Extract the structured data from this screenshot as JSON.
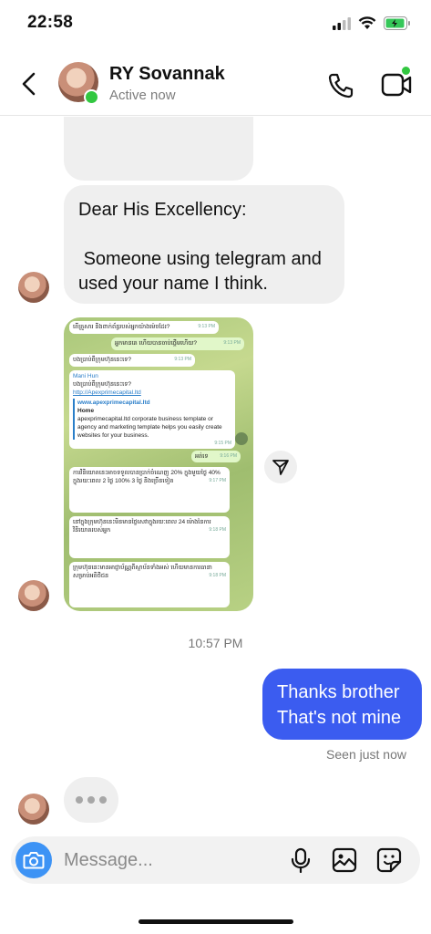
{
  "status_bar": {
    "time": "22:58"
  },
  "header": {
    "name": "RY Sovannak",
    "status": "Active now"
  },
  "messages": {
    "incoming_text": "Dear His Excellency:\n\n Someone using telegram and used your name I think.",
    "timestamp": "10:57 PM",
    "outgoing_text": "Thanks brother\nThat's not mine",
    "seen": "Seen just now"
  },
  "embedded_screenshot": {
    "lines": [
      {
        "text": "តើគ្រួសារ និងពាក់ព័ន្ធរបស់អ្នកយ៉ាងម៉េចដែរ?",
        "time": "9:13 PM"
      },
      {
        "text": "អ្នកមានគេ ហើយបានចាប់ផ្តើមហើយ?",
        "time": "9:13 PM"
      },
      {
        "text": "បងប្រាប់ពីក្រុមហ៊ុននេះទេ?",
        "time": "9:13 PM"
      },
      {
        "text": "Mani Hun",
        "time": ""
      },
      {
        "text": "បងប្រាប់ពីក្រុមហ៊ុននេះទេ?",
        "time": ""
      },
      {
        "text": "http://Apexprimecapital.ltd",
        "time": ""
      },
      {
        "text": "www.apexprimecapital.ltd",
        "time": ""
      },
      {
        "text": "Home",
        "time": ""
      },
      {
        "text": "apexprimecapital.ltd corporate business template or agency and marketing template helps you easily create websites for your business.",
        "time": "9:15 PM"
      },
      {
        "text": "អត់ទេ",
        "time": "9:16 PM"
      },
      {
        "text": "ការវិនិយោគនេះអាចទទួលបានប្រាក់ចំណេញ 20% ក្នុងមួយថ្ងៃ 40% ក្នុងរយៈពេល 2 ថ្ងៃ 100% 3 ថ្ងៃ និងច្រើនទៀត",
        "time": "9:17 PM"
      },
      {
        "text": "នៅក្នុងក្រុមហ៊ុននេះមិនមានថ្លៃសេវាក្នុងរយៈពេល 24 ម៉ោងនៃការវិនិយោគរបស់អ្នក",
        "time": "9:18 PM"
      },
      {
        "text": "ក្រុមហ៊ុននេះមានអាជ្ញាប័ណ្ណពីស្ថាប័នទាំងអស់ ហើយមានការធានាសម្រាប់អតិថិជន",
        "time": "9:18 PM"
      }
    ]
  },
  "composer": {
    "placeholder": "Message..."
  },
  "icons": {
    "back": "chevron-left-icon",
    "call": "phone-icon",
    "video": "video-icon",
    "share": "send-icon",
    "camera": "camera-icon",
    "mic": "microphone-icon",
    "gallery": "image-icon",
    "sticker": "sticker-icon"
  },
  "colors": {
    "outgoing_bubble": "#3b5cf0",
    "incoming_bubble": "#efefef",
    "online": "#32c740",
    "camera_button": "#3d93f5"
  }
}
